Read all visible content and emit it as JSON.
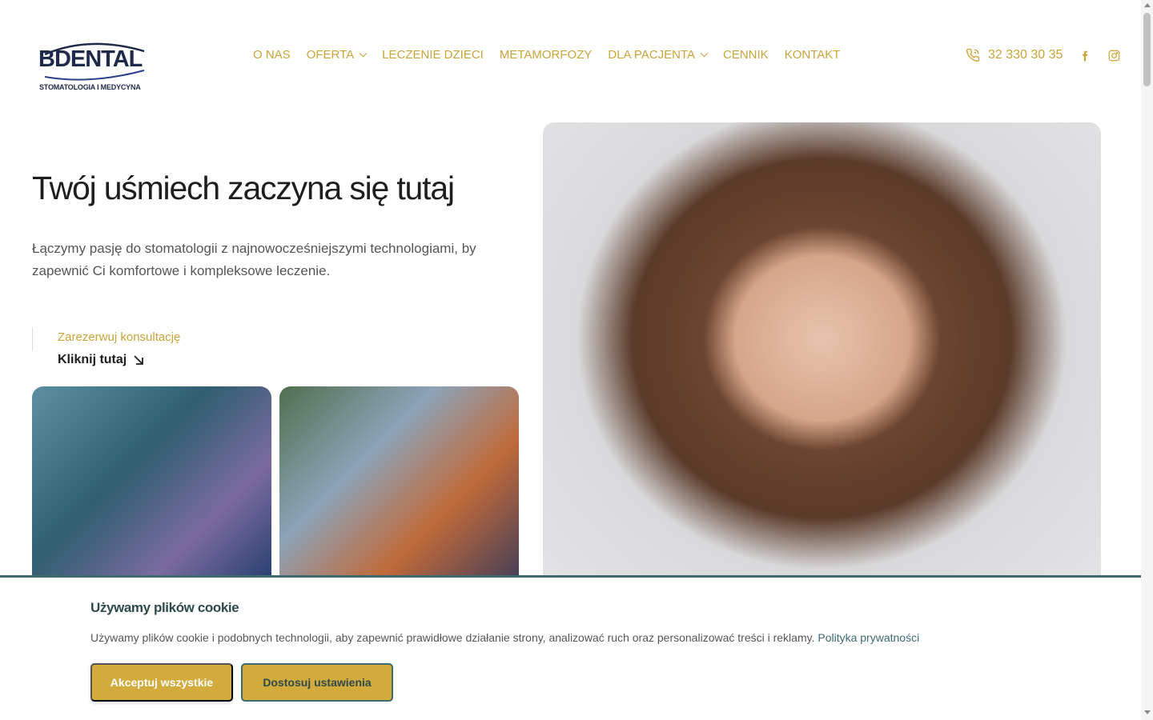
{
  "brand": {
    "name": "BDENTAL",
    "tagline": "STOMATOLOGIA I MEDYCYNA",
    "color": "#1f2a4a"
  },
  "nav": {
    "items": [
      {
        "label": "O NAS",
        "has_dropdown": false
      },
      {
        "label": "OFERTA",
        "has_dropdown": true
      },
      {
        "label": "LECZENIE DZIECI",
        "has_dropdown": false
      },
      {
        "label": "METAMORFOZY",
        "has_dropdown": false
      },
      {
        "label": "DLA PACJENTA",
        "has_dropdown": true
      },
      {
        "label": "CENNIK",
        "has_dropdown": false
      },
      {
        "label": "KONTAKT",
        "has_dropdown": false
      }
    ],
    "accent_color": "#c9a43a"
  },
  "contact": {
    "phone": "32 330 30 35",
    "phone_icon": "phone-icon",
    "social": [
      "facebook-icon",
      "instagram-icon"
    ]
  },
  "hero": {
    "title": "Twój uśmiech zaczyna się tutaj",
    "text": "Łączymy pasję do stomatologii z najnowocześniejszymi technologiami, by zapewnić Ci komfortowe i kompleksowe leczenie.",
    "cta_label": "Zarezerwuj konsultację",
    "cta_link": "Kliknij tutaj"
  },
  "cookie": {
    "title": "Używamy plików cookie",
    "text": "Używamy plików cookie i podobnych technologii, aby zapewnić prawidłowe działanie strony, analizować ruch oraz personalizować treści i reklamy.",
    "policy_link": "Polityka prywatności",
    "accept_label": "Akceptuj wszystkie",
    "customize_label": "Dostosuj ustawienia",
    "accent_color": "#d2ab3c",
    "border_color": "#3d6a6e"
  }
}
